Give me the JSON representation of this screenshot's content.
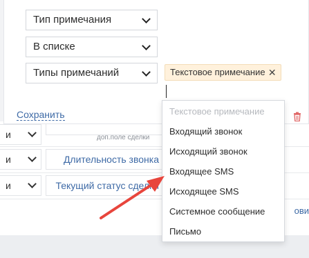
{
  "filter_panel": {
    "field1_value": "Тип примечания",
    "field2_value": "В списке",
    "field3_value": "Типы примечаний",
    "selected_tag": "Текстовое примечание",
    "save_label": "Сохранить"
  },
  "dropdown": {
    "options": [
      {
        "label": "Текстовое примечание",
        "disabled": true
      },
      {
        "label": "Входящий звонок",
        "disabled": false
      },
      {
        "label": "Исходящий звонок",
        "disabled": false
      },
      {
        "label": "Входящее SMS",
        "disabled": false
      },
      {
        "label": "Исходящее SMS",
        "disabled": false
      },
      {
        "label": "Системное сообщение",
        "disabled": false
      },
      {
        "label": "Письмо",
        "disabled": false
      }
    ]
  },
  "background_rows": {
    "row1_condition": "и",
    "row1_sub": "доп.поле сделки",
    "row2_condition": "и",
    "row2_field": "Длительность звонка",
    "row3_condition": "и",
    "row3_field": "Текущий статус сделки",
    "right_link": "ови"
  },
  "colors": {
    "link": "#3e6aa6",
    "tag_bg": "#fff1dc",
    "arrow": "#e8453c",
    "trash": "#e06666"
  }
}
